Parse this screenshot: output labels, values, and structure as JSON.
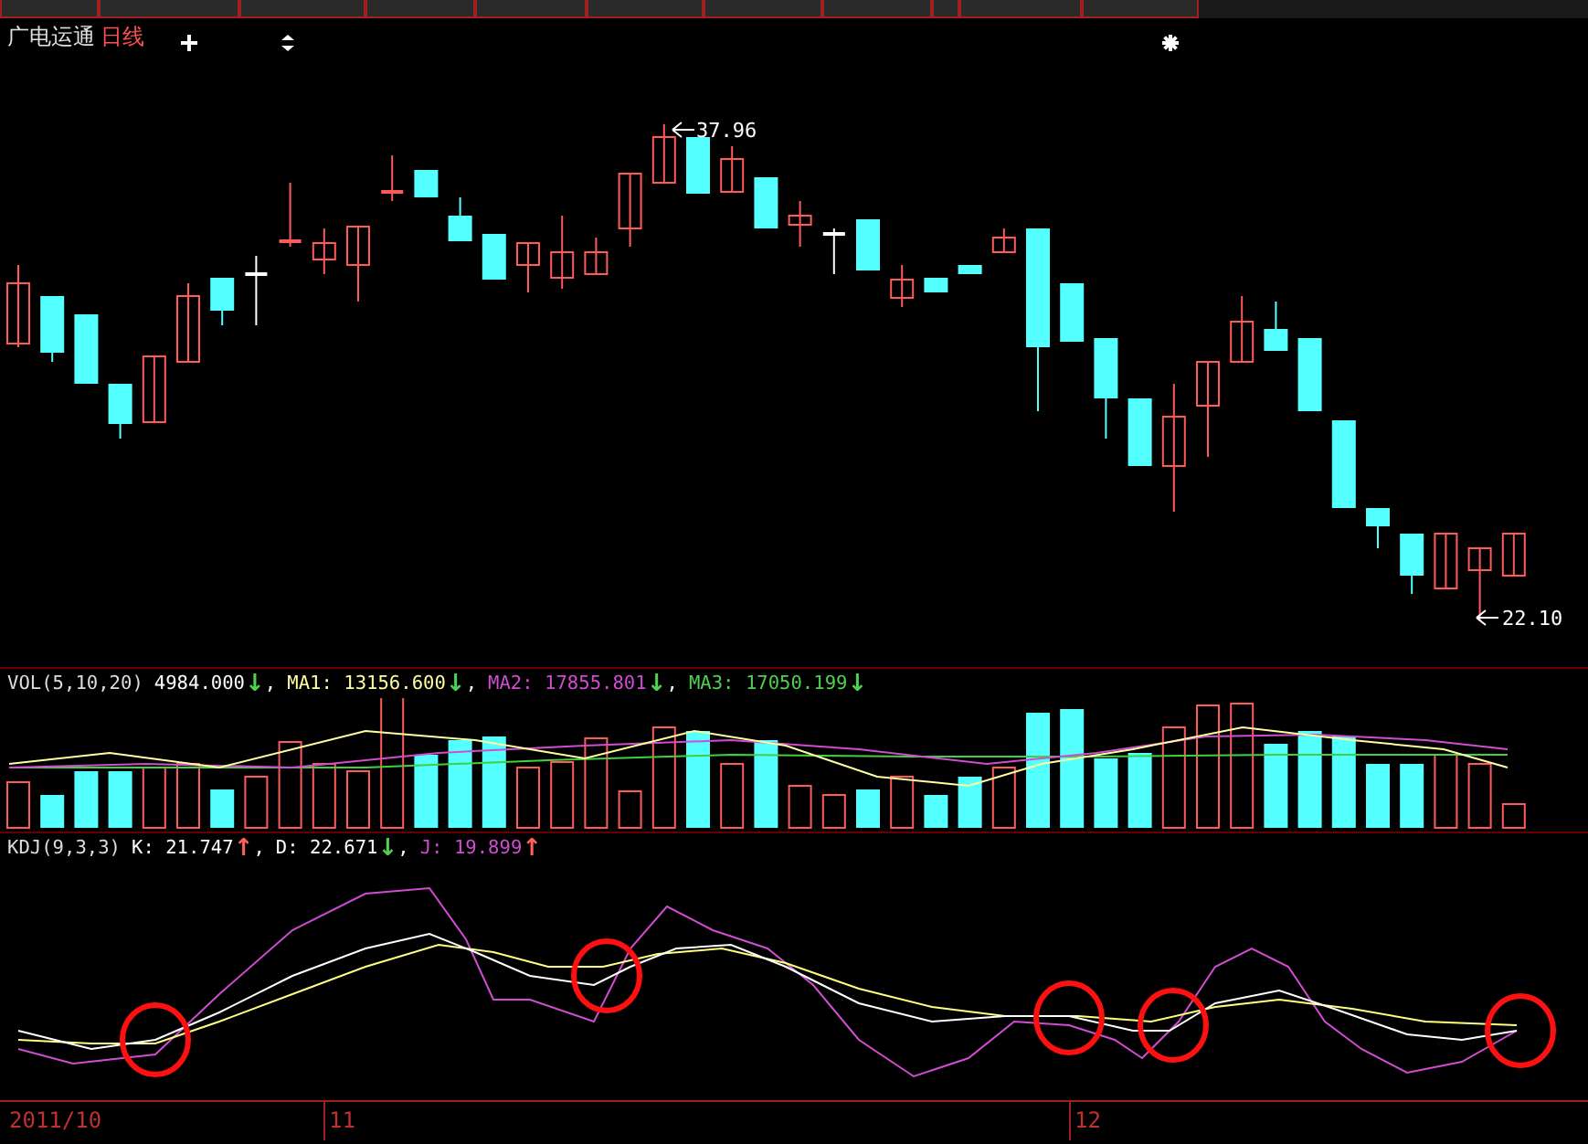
{
  "header": {
    "stock_name": "广电运通",
    "period": "日线"
  },
  "price_chart": {
    "high_label": "37.96",
    "low_label": "22.10"
  },
  "volume": {
    "indicator": "VOL(5,10,20)",
    "readings": [
      {
        "value": "4984.000",
        "arrow": {
          "text": "↓",
          "color": "#50d050"
        },
        "color": "#ffffff",
        "separator": ","
      },
      {
        "label": "MA1:",
        "value": "13156.600",
        "arrow": {
          "text": "↓",
          "color": "#50d050"
        },
        "color": "#ffffa0",
        "separator": ","
      },
      {
        "label": "MA2:",
        "value": "17855.801",
        "arrow": {
          "text": "↓",
          "color": "#50d050"
        },
        "color": "#d04cd0",
        "separator": ","
      },
      {
        "label": "MA3:",
        "value": "17050.199",
        "arrow": {
          "text": "↓",
          "color": "#50d050"
        },
        "color": "#50d050"
      }
    ]
  },
  "kdj": {
    "indicator": "KDJ(9,3,3)",
    "readings": [
      {
        "label": "K:",
        "value": "21.747",
        "arrow": {
          "text": "↑",
          "color": "#ff6060"
        },
        "color": "#ffffff",
        "separator": ","
      },
      {
        "label": "D:",
        "value": "22.671",
        "arrow": {
          "text": "↓",
          "color": "#50d050"
        },
        "color": "#ffffff",
        "separator": ","
      },
      {
        "label": "J:",
        "value": "19.899",
        "arrow": {
          "text": "↑",
          "color": "#ff6060"
        },
        "color": "#d04cd0"
      }
    ]
  },
  "time_axis": {
    "labels": [
      "2011/10",
      "11",
      "12"
    ]
  }
}
